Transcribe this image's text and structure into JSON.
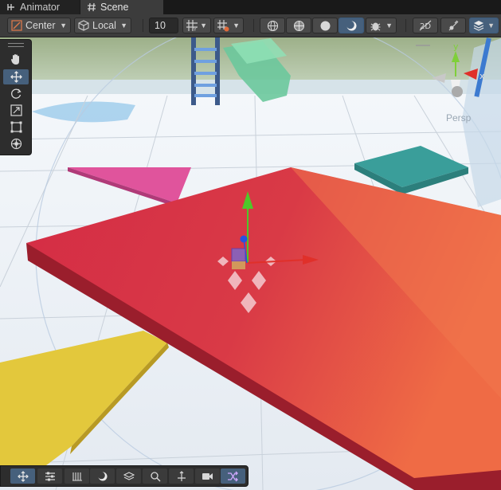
{
  "tabs": [
    {
      "label": "Animator",
      "icon": "animator-icon"
    },
    {
      "label": "Scene",
      "icon": "scene-hash-icon"
    }
  ],
  "toolbar": {
    "pivot_label": "Center",
    "space_label": "Local",
    "snap_value": "10"
  },
  "scene": {
    "projection_label": "Persp",
    "gizmo_axes": [
      "y",
      "x"
    ]
  },
  "colors": {
    "accent": "#46607c",
    "floor": "#eef3f8",
    "red_plane": "#d63a48",
    "pink_plane": "#e0549c",
    "teal_plane": "#3a9e9a",
    "yellow_plane": "#e3c83c"
  }
}
